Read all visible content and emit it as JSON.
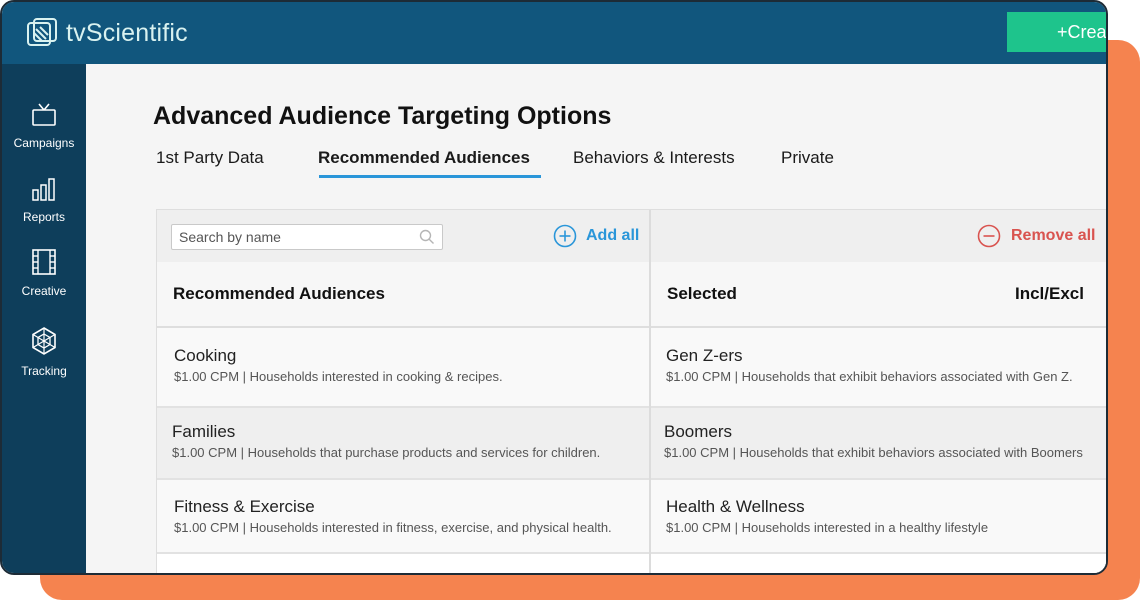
{
  "app": {
    "logo_text": "tvScientific",
    "create_label": "+Crea"
  },
  "sidebar": {
    "items": [
      {
        "label": "Campaigns",
        "icon": "tv-icon"
      },
      {
        "label": "Reports",
        "icon": "bar-chart-icon"
      },
      {
        "label": "Creative",
        "icon": "film-icon"
      },
      {
        "label": "Tracking",
        "icon": "web-icon"
      }
    ]
  },
  "page": {
    "title": "Advanced Audience Targeting Options",
    "tabs": [
      {
        "label": "1st Party Data",
        "active": false
      },
      {
        "label": "Recommended Audiences",
        "active": true
      },
      {
        "label": "Behaviors & Interests",
        "active": false
      },
      {
        "label": "Private",
        "active": false
      }
    ]
  },
  "toolbar": {
    "search_placeholder": "Search by name",
    "add_all_label": "Add all",
    "remove_all_label": "Remove all"
  },
  "headers": {
    "left": "Recommended Audiences",
    "selected": "Selected",
    "incl_excl": "Incl/Excl"
  },
  "rows": [
    {
      "left_name": "Cooking",
      "left_desc": "$1.00 CPM | Households interested in cooking & recipes.",
      "right_name": "Gen Z-ers",
      "right_desc": "$1.00 CPM | Households that exhibit behaviors associated with Gen Z."
    },
    {
      "left_name": "Families",
      "left_desc": "$1.00 CPM | Households that purchase products and services for children.",
      "right_name": "Boomers",
      "right_desc": "$1.00 CPM | Households that exhibit behaviors associated with Boomers"
    },
    {
      "left_name": "Fitness & Exercise",
      "left_desc": "$1.00 CPM | Households interested in fitness, exercise, and physical health.",
      "right_name": "Health & Wellness",
      "right_desc": "$1.00 CPM | Households interested in a healthy lifestyle"
    }
  ],
  "colors": {
    "topbar": "#11567d",
    "sidebar": "#0e3e5b",
    "accent_blue": "#2a96d9",
    "accent_green": "#1ec48c",
    "remove_red": "#d9534f",
    "backdrop_orange": "#f5834f"
  }
}
